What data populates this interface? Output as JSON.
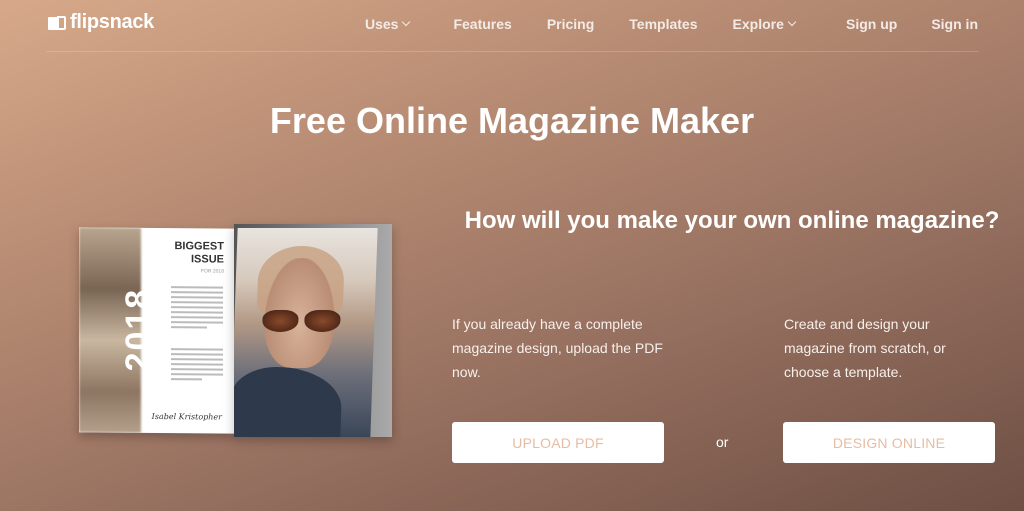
{
  "brand": {
    "name": "flipsnack",
    "logo_icon": "book-page-icon"
  },
  "nav": {
    "links": [
      {
        "label": "Uses",
        "has_dropdown": true
      },
      {
        "label": "Features",
        "has_dropdown": false
      },
      {
        "label": "Pricing",
        "has_dropdown": false
      },
      {
        "label": "Templates",
        "has_dropdown": false
      },
      {
        "label": "Explore",
        "has_dropdown": true
      }
    ],
    "sign_up": "Sign up",
    "sign_in": "Sign in"
  },
  "hero": {
    "title": "Free Online Magazine Maker",
    "question": "How will you make your own online magazine?",
    "option_left": {
      "description": "If you already have a complete magazine design, upload the PDF now.",
      "button": "UPLOAD PDF"
    },
    "separator": "or",
    "option_right": {
      "description": "Create and design your magazine from scratch, or choose a template.",
      "button": "DESIGN ONLINE"
    }
  },
  "magazine_mockup": {
    "headline": "BIGGEST ISSUE",
    "subline": "FOR 2018",
    "year": "2018",
    "signature": "Isabel Kristopher"
  },
  "colors": {
    "gradient_start": "#d7a98a",
    "gradient_end": "#6e4f44",
    "button_text": "#e6bda3",
    "text": "#ffffff"
  }
}
